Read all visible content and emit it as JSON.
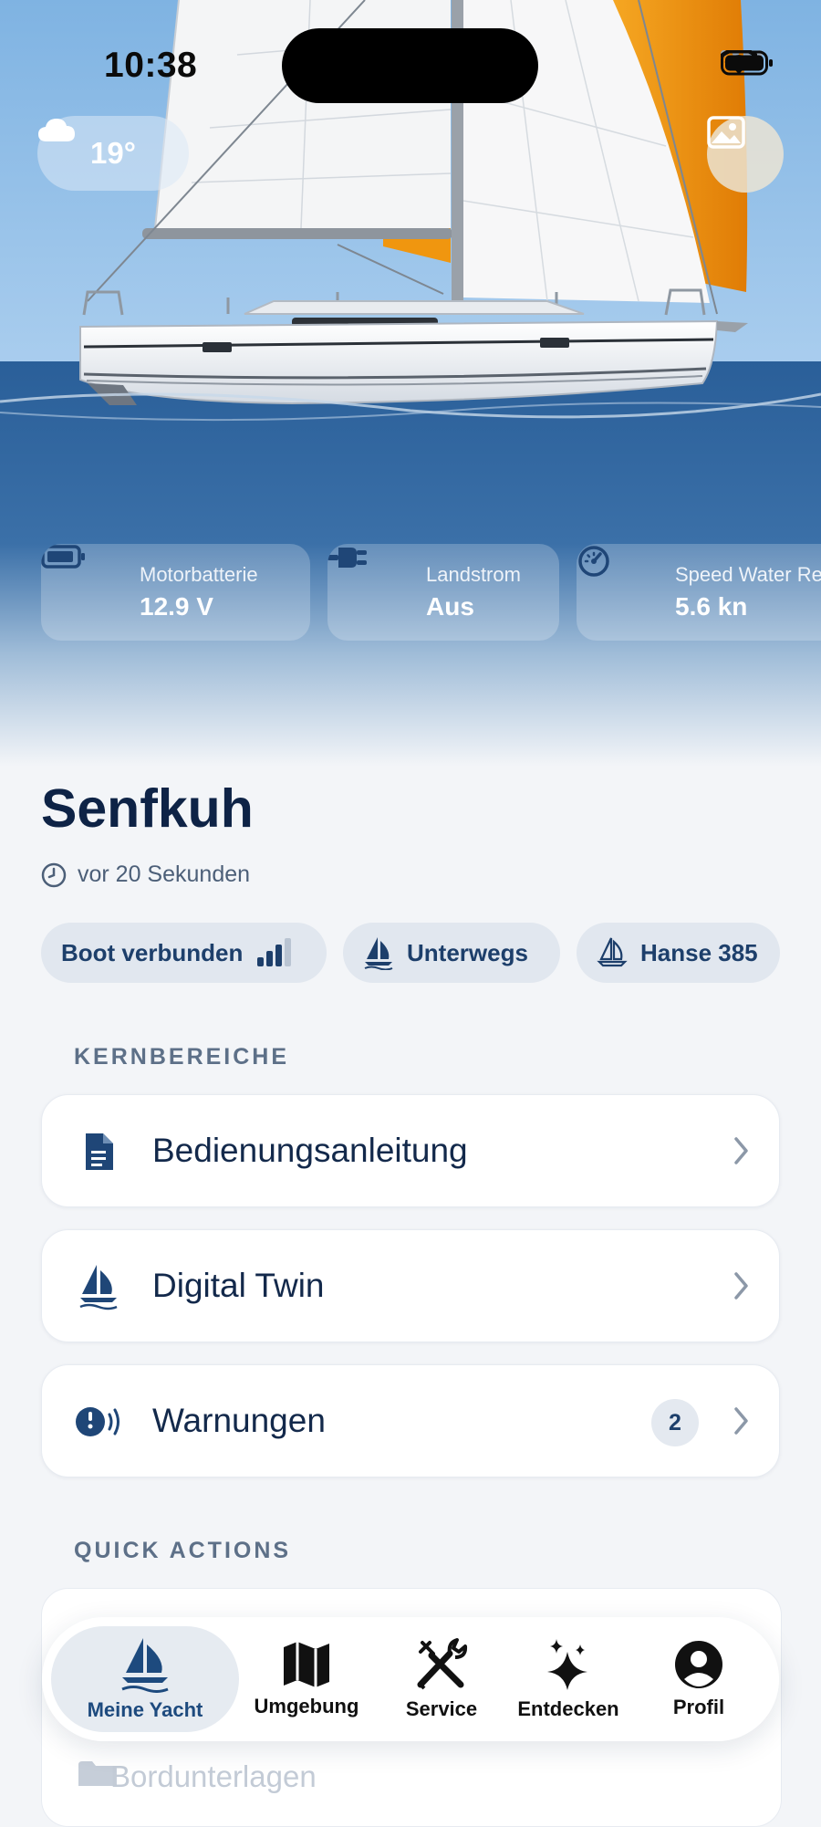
{
  "status_bar": {
    "time": "10:38"
  },
  "weather": {
    "temperature": "19°",
    "icon": "cloud-icon"
  },
  "sensors": [
    {
      "label": "Motorbatterie",
      "value": "12.9 V",
      "icon": "battery-icon"
    },
    {
      "label": "Landstrom",
      "value": "Aus",
      "icon": "plug-icon"
    },
    {
      "label": "Speed Water Re",
      "value": "5.6 kn",
      "icon": "speedometer-icon"
    }
  ],
  "yacht": {
    "name": "Senfkuh",
    "updated": "vor 20 Sekunden"
  },
  "chips": [
    {
      "label": "Boot verbunden",
      "icon": "signal-bars-icon"
    },
    {
      "label": "Unterwegs",
      "icon": "sailboat-icon"
    },
    {
      "label": "Hanse 385",
      "icon": "sailboat-outline-icon"
    }
  ],
  "sections": {
    "core": "KERNBEREICHE",
    "quick": "QUICK ACTIONS"
  },
  "core_items": [
    {
      "label": "Bedienungsanleitung",
      "icon": "document-icon"
    },
    {
      "label": "Digital Twin",
      "icon": "sailboat-icon"
    },
    {
      "label": "Warnungen",
      "icon": "alert-broadcast-icon",
      "badge": "2"
    }
  ],
  "quick_items": [
    {
      "label": "Bordunterlagen",
      "icon": "folder-icon"
    }
  ],
  "tabbar": [
    {
      "label": "Meine Yacht",
      "icon": "sailboat-icon",
      "active": true
    },
    {
      "label": "Umgebung",
      "icon": "map-icon"
    },
    {
      "label": "Service",
      "icon": "tools-icon"
    },
    {
      "label": "Entdecken",
      "icon": "sparkles-icon"
    },
    {
      "label": "Profil",
      "icon": "profile-icon"
    }
  ],
  "colors": {
    "sky": "#8dbde6",
    "sea": "#2f66a0",
    "accent_sail": "#f0960f",
    "primary_text": "#0e2346",
    "background": "#f3f5f8"
  }
}
